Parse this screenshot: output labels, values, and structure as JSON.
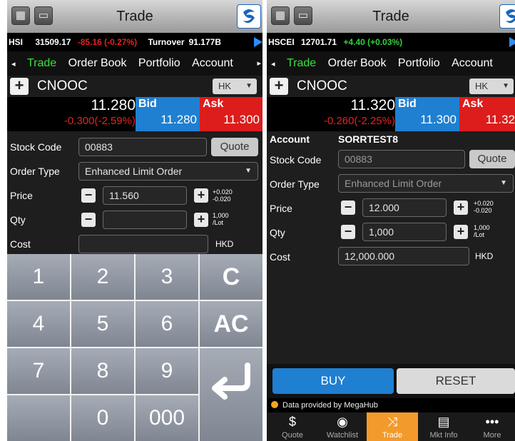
{
  "left": {
    "title": "Trade",
    "ticker": {
      "index": "HSI",
      "value": "31509.17",
      "change": "-85.16 (-0.27%)",
      "turnover_label": "Turnover",
      "turnover": "91.177B"
    },
    "nav": {
      "back": "◂",
      "tabs": [
        "Trade",
        "Order Book",
        "Portfolio",
        "Account"
      ],
      "more": "▸"
    },
    "stock": {
      "name": "CNOOC",
      "market": "HK"
    },
    "quote": {
      "last": "11.280",
      "change": "-0.300(-2.59%)",
      "bid_label": "Bid",
      "bid": "11.280",
      "ask_label": "Ask",
      "ask": "11.300"
    },
    "form": {
      "stock_code_label": "Stock Code",
      "stock_code": "00883",
      "quote_button": "Quote",
      "order_type_label": "Order Type",
      "order_type": "Enhanced Limit Order",
      "price_label": "Price",
      "price": "11.560",
      "price_up": "+0.020",
      "price_down": "-0.020",
      "qty_label": "Qty",
      "qty": "",
      "lot_size": "1,000",
      "lot_unit": "/Lot",
      "cost_label": "Cost",
      "cost": "",
      "currency": "HKD"
    },
    "keypad": [
      "1",
      "2",
      "3",
      "C",
      "4",
      "5",
      "6",
      "AC",
      "7",
      "8",
      "9",
      "0",
      "000"
    ]
  },
  "right": {
    "title": "Trade",
    "ticker": {
      "index": "HSCEI",
      "value": "12701.71",
      "change": "+4.40 (+0.03%)"
    },
    "nav": {
      "back": "◂",
      "tabs": [
        "Trade",
        "Order Book",
        "Portfolio",
        "Account"
      ]
    },
    "stock": {
      "name": "CNOOC",
      "market": "HK"
    },
    "quote": {
      "last": "11.320",
      "change": "-0.260(-2.25%)",
      "bid_label": "Bid",
      "bid": "11.300",
      "ask_label": "Ask",
      "ask": "11.32"
    },
    "form": {
      "account_label": "Account",
      "account": "SORRTEST8",
      "stock_code_label": "Stock Code",
      "stock_code": "00883",
      "quote_button": "Quote",
      "order_type_label": "Order Type",
      "order_type": "Enhanced Limit Order",
      "price_label": "Price",
      "price": "12.000",
      "price_up": "+0.020",
      "price_down": "-0.020",
      "qty_label": "Qty",
      "qty": "1,000",
      "lot_size": "1,000",
      "lot_unit": "/Lot",
      "cost_label": "Cost",
      "cost": "12,000.000",
      "currency": "HKD"
    },
    "actions": {
      "buy": "BUY",
      "reset": "RESET"
    },
    "provider": "Data provided by MegaHub",
    "tabbar": [
      "Quote",
      "Watchlist",
      "Trade",
      "Mkt Info",
      "More"
    ]
  },
  "colors": {
    "bid": "#1f7fd1",
    "ask": "#dd1c1c",
    "active_tab": "#39e03f",
    "trade_tab": "#f39a2c"
  }
}
